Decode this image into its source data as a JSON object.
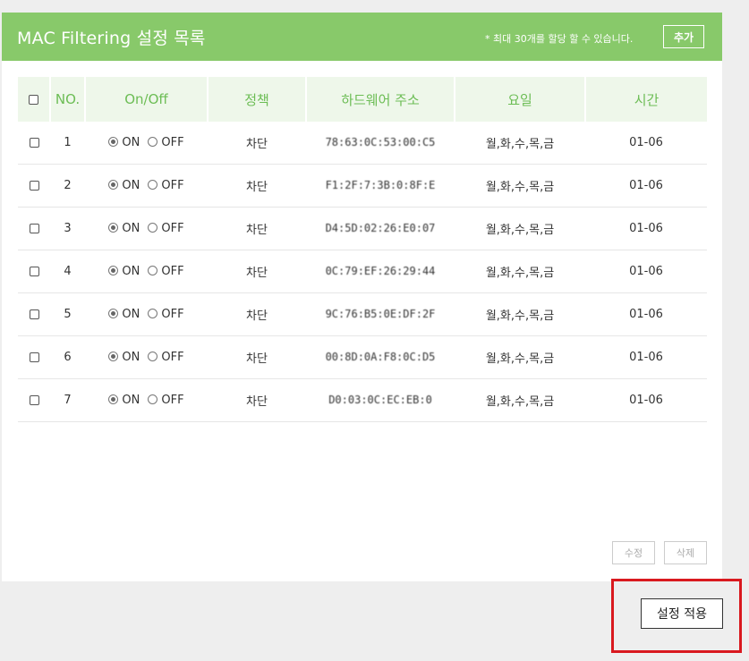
{
  "panel": {
    "title": "MAC Filtering 설정 목록",
    "note": "* 최대 30개를 할당 할 수 있습니다.",
    "add_label": "추가"
  },
  "table": {
    "headers": [
      "NO.",
      "On/Off",
      "정책",
      "하드웨어 주소",
      "요일",
      "시간"
    ],
    "radio_on_label": "ON",
    "radio_off_label": "OFF",
    "rows": [
      {
        "no": "1",
        "state": "ON",
        "policy": "차단",
        "mac": "78:63:0C:53:00:C5",
        "days": "월,화,수,목,금",
        "time": "01-06"
      },
      {
        "no": "2",
        "state": "ON",
        "policy": "차단",
        "mac": "F1:2F:7:3B:0:8F:E",
        "days": "월,화,수,목,금",
        "time": "01-06"
      },
      {
        "no": "3",
        "state": "ON",
        "policy": "차단",
        "mac": "D4:5D:02:26:E0:07",
        "days": "월,화,수,목,금",
        "time": "01-06"
      },
      {
        "no": "4",
        "state": "ON",
        "policy": "차단",
        "mac": "0C:79:EF:26:29:44",
        "days": "월,화,수,목,금",
        "time": "01-06"
      },
      {
        "no": "5",
        "state": "ON",
        "policy": "차단",
        "mac": "9C:76:B5:0E:DF:2F",
        "days": "월,화,수,목,금",
        "time": "01-06"
      },
      {
        "no": "6",
        "state": "ON",
        "policy": "차단",
        "mac": "00:8D:0A:F8:0C:D5",
        "days": "월,화,수,목,금",
        "time": "01-06"
      },
      {
        "no": "7",
        "state": "ON",
        "policy": "차단",
        "mac": "D0:03:0C:EC:EB:0",
        "days": "월,화,수,목,금",
        "time": "01-06"
      }
    ]
  },
  "buttons": {
    "edit_label": "수정",
    "delete_label": "삭제",
    "apply_label": "설정 적용"
  },
  "colors": {
    "header_green": "#88c96a",
    "table_header_bg": "#eef7ea",
    "table_header_text": "#6cbd55",
    "highlight_red": "#d9191f"
  }
}
